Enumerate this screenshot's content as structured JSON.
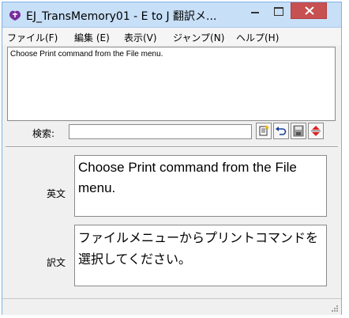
{
  "window": {
    "title": "EJ_TransMemory01 - E to J 翻訳メ...",
    "close_color": "#c75050"
  },
  "menu": {
    "items": [
      "ファイル(F)",
      "編集 (E)",
      "表示(V)",
      "ジャンプ(N)",
      "ヘルプ(H)"
    ]
  },
  "preview": {
    "text": "Choose Print command from the File menu."
  },
  "search": {
    "label": "検索:",
    "value": ""
  },
  "fields": {
    "english_label": "英文",
    "english_text": "Choose Print command from the File menu.",
    "japanese_label": "訳文",
    "japanese_text": "ファイルメニューからプリントコマンドを選択してください。"
  },
  "icons": [
    "app-icon",
    "minimize-icon",
    "maximize-icon",
    "close-icon",
    "new-entry-icon",
    "undo-icon",
    "save-icon",
    "scroll-arrows-icon",
    "resize-grip-icon"
  ]
}
